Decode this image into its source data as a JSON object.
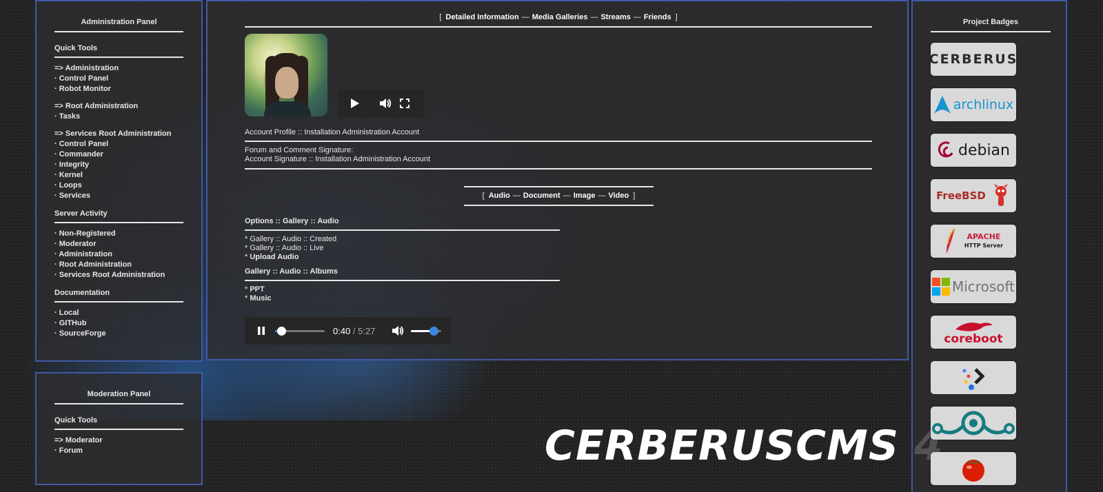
{
  "admin_panel": {
    "title": "Administration Panel",
    "sections": [
      {
        "title": "Quick Tools",
        "groups": [
          [
            "=> Administration",
            "· Control Panel",
            "· Robot Monitor"
          ],
          [
            "=> Root Administration",
            "· Tasks"
          ],
          [
            "=> Services Root Administration",
            "· Control Panel",
            "· Commander",
            "· Integrity",
            "· Kernel",
            "· Loops",
            "· Services"
          ]
        ]
      },
      {
        "title": "Server Activity",
        "groups": [
          [
            "· Non-Registered",
            "· Moderator",
            "· Administration",
            "· Root Administration",
            "· Services Root Administration"
          ]
        ]
      },
      {
        "title": "Documentation",
        "groups": [
          [
            "· Local",
            "· GITHub",
            "· SourceForge"
          ]
        ]
      }
    ]
  },
  "moderation_panel": {
    "title": "Moderation Panel",
    "section_title": "Quick Tools",
    "items": [
      "=> Moderator",
      "· Forum"
    ]
  },
  "top_nav": {
    "open": "[",
    "close": "]",
    "separator": "—",
    "items": [
      "Detailed Information",
      "Media Galleries",
      "Streams",
      "Friends"
    ]
  },
  "profile": {
    "account_line": "Account Profile :: Installation Administration Account",
    "signature_label": "Forum and Comment Signature:",
    "signature_value": "Account Signature :: Installation Administration Account"
  },
  "sub_nav": {
    "open": "[",
    "close": "]",
    "separator": "—",
    "items": [
      "Audio",
      "Document",
      "Image",
      "Video"
    ]
  },
  "gallery": {
    "options_title": "Options :: Gallery :: Audio",
    "options": [
      {
        "prefix": "* ",
        "text": "Gallery :: Audio :: Created",
        "bold": false
      },
      {
        "prefix": "* ",
        "text": "Gallery :: Audio :: Live",
        "bold": false
      },
      {
        "prefix": "* ",
        "text": "Upload Audio",
        "bold": true
      }
    ],
    "albums_title": "Gallery :: Audio :: Albums",
    "albums": [
      {
        "prefix": "* ",
        "text": "PPT"
      },
      {
        "prefix": "* ",
        "text": "Music"
      }
    ]
  },
  "audio_player": {
    "current_time": "0:40",
    "separator": " / ",
    "duration": "5:27",
    "progress": 0.122,
    "volume": 0.75
  },
  "brand": {
    "title": "CERBERUSCMS 4"
  },
  "badges": {
    "title": "Project Badges",
    "items": [
      {
        "name": "cerberus",
        "label": "CERBERUS",
        "color": "#2b2b2b"
      },
      {
        "name": "archlinux",
        "label": "archlinux",
        "color": "#1793d1"
      },
      {
        "name": "debian",
        "label": "debian",
        "color": "#a80030"
      },
      {
        "name": "freebsd",
        "label": "FreeBSD",
        "color": "#ab2b28"
      },
      {
        "name": "apache",
        "label": "APACHE",
        "sublabel": "HTTP Server",
        "color": "#c92037"
      },
      {
        "name": "microsoft",
        "label": "Microsoft",
        "color": "#737373"
      },
      {
        "name": "coreboot",
        "label": "coreboot",
        "color": "#c8102e"
      },
      {
        "name": "terminal",
        "label": "",
        "color": "#222222"
      },
      {
        "name": "lineageos",
        "label": "",
        "color": "#167c80"
      },
      {
        "name": "tomato",
        "label": "",
        "color": "#d81e05"
      }
    ]
  }
}
